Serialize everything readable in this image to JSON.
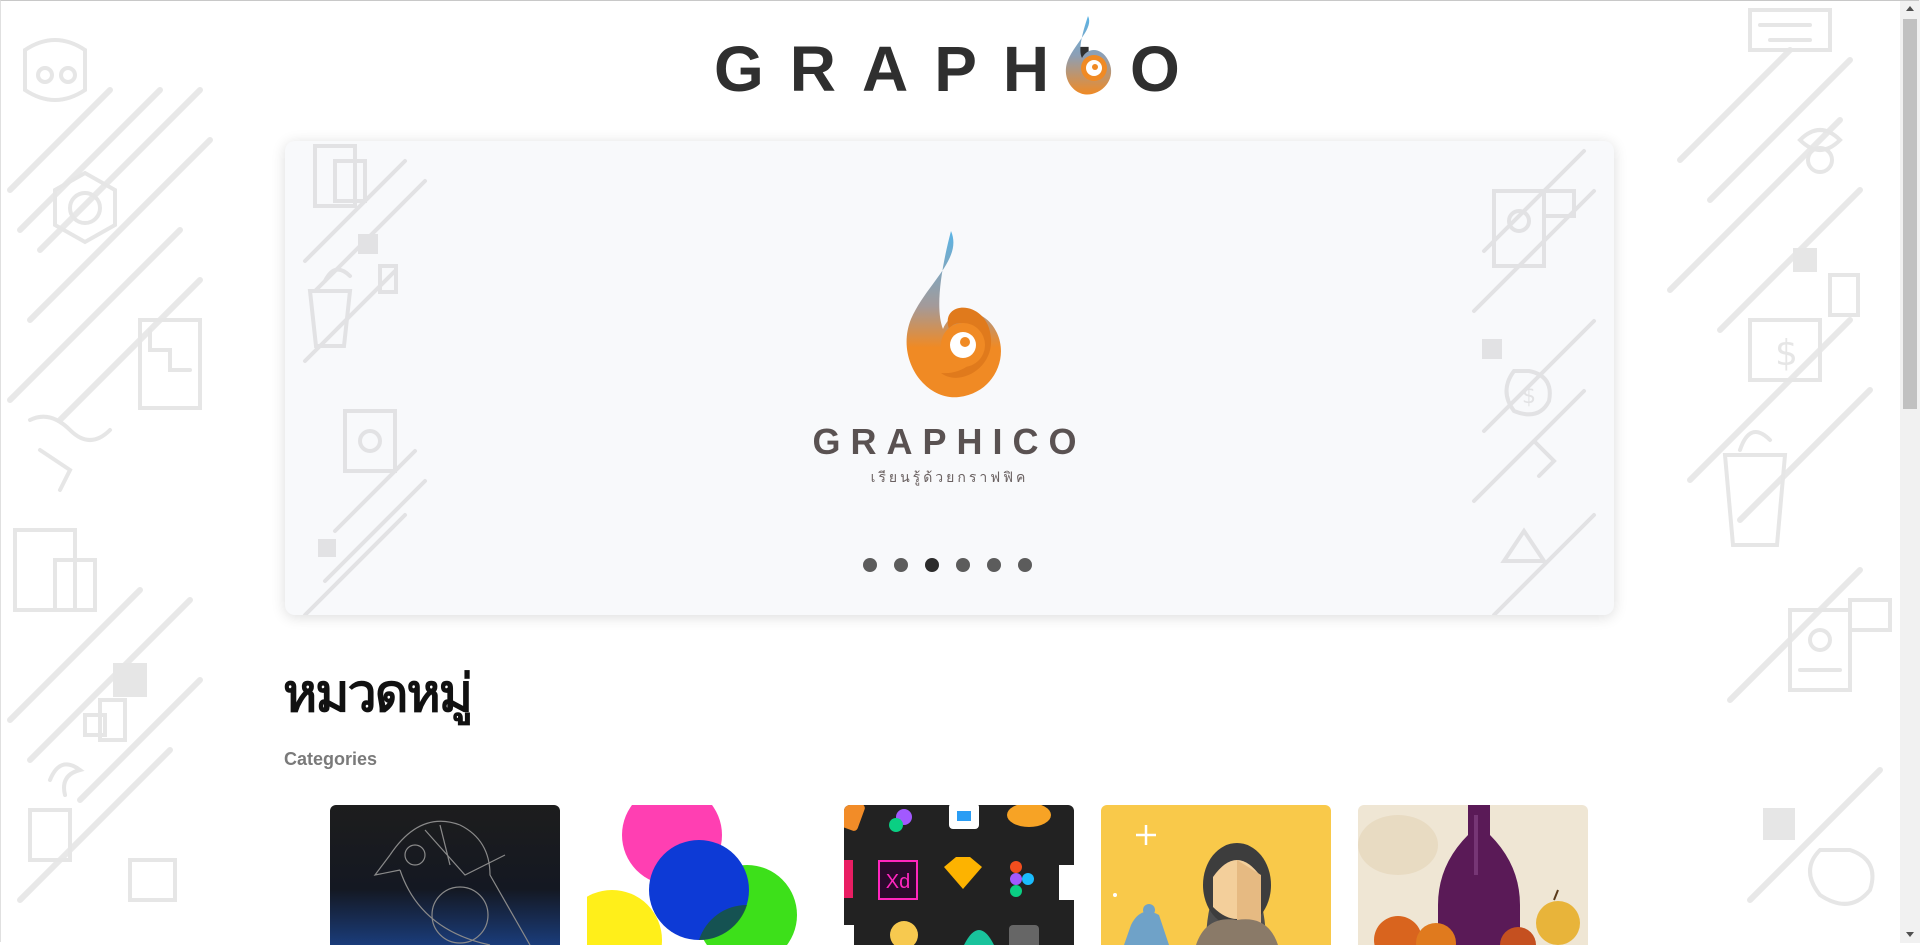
{
  "brand": {
    "logo_left": "GRAPHI",
    "logo_right": "O",
    "accent_orange": "#f08a24",
    "accent_blue": "#5ab4e6"
  },
  "hero": {
    "title": "GRAPHICO",
    "subtitle": "เรียนรู้ด้วยกราฟฟิค",
    "slide_count": 6,
    "active_slide": 3
  },
  "categories": {
    "title": "หมวดหมู่",
    "subtitle": "Categories",
    "cards": [
      {
        "name": "vector-bird",
        "bg": "#1b1b1b"
      },
      {
        "name": "color-circles",
        "bg": "#ffffff"
      },
      {
        "name": "app-icons",
        "bg": "#222222"
      },
      {
        "name": "character-illustration",
        "bg": "#f7c64f"
      },
      {
        "name": "watercolor-painting",
        "bg": "#f1e8d8"
      }
    ],
    "app_icon_label": "Xd"
  },
  "icons": {
    "scroll_up": "triangle-up-icon",
    "scroll_down": "triangle-down-icon"
  }
}
